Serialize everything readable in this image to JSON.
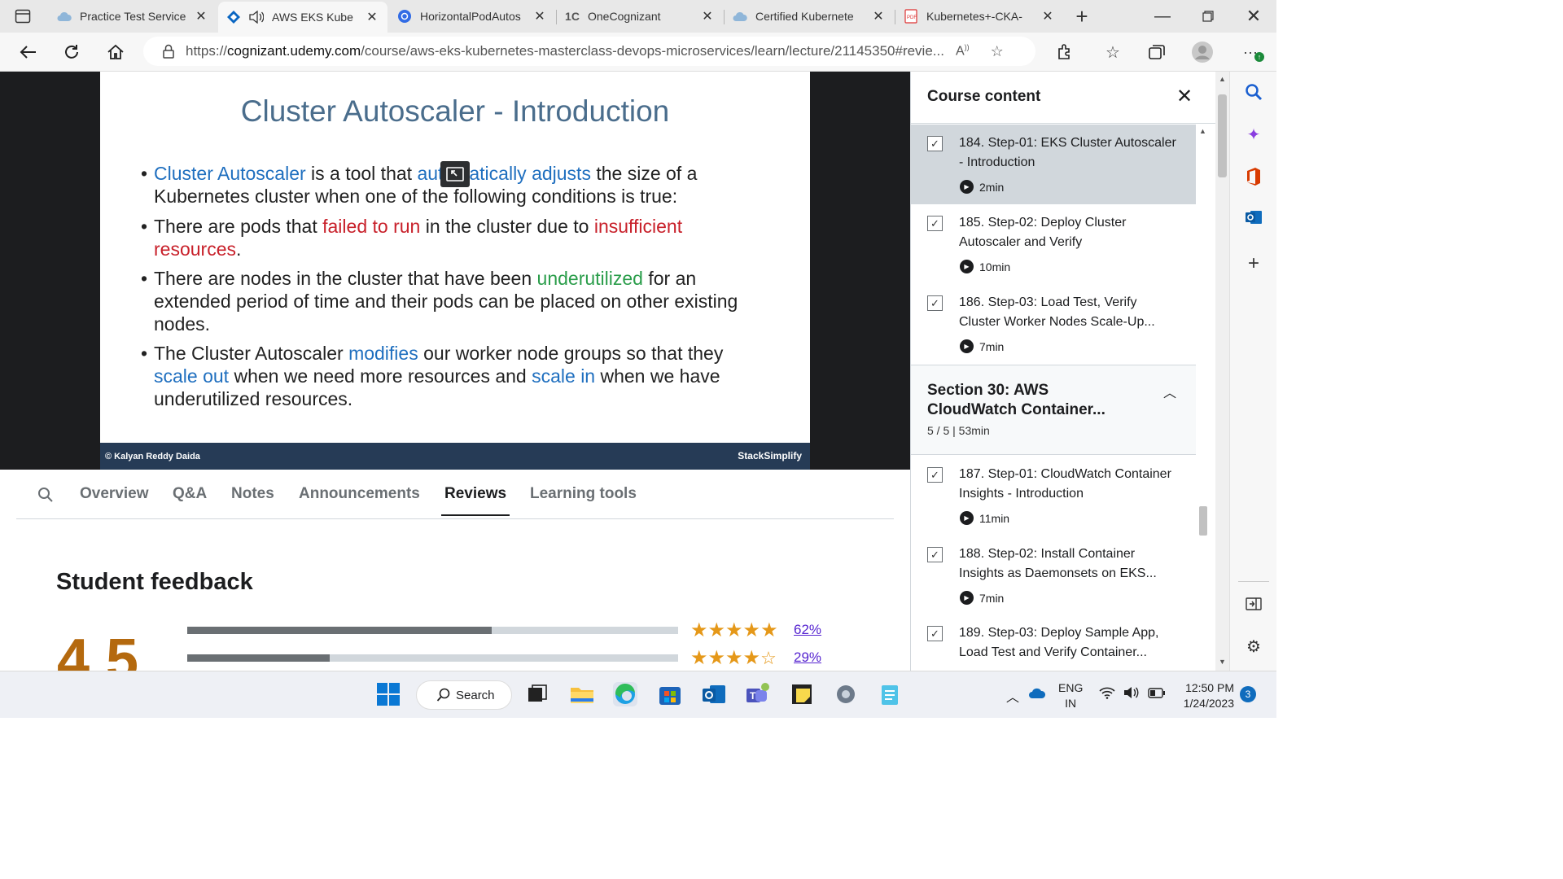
{
  "browser": {
    "tabs": [
      {
        "label": "Practice Test Service",
        "icon": "cloud-icon",
        "active": false
      },
      {
        "label": "AWS EKS Kube",
        "icon": "udemy-icon",
        "active": true,
        "audio": true
      },
      {
        "label": "HorizontalPodAutos",
        "icon": "kubernetes-icon",
        "active": false
      },
      {
        "label": "OneCognizant",
        "icon": "onecognizant-icon",
        "active": false
      },
      {
        "label": "Certified Kubernete",
        "icon": "cloud-icon",
        "active": false
      },
      {
        "label": "Kubernetes+-CKA-",
        "icon": "pdf-icon",
        "active": false
      }
    ],
    "url_prefix": "https://",
    "url_host": "cognizant.udemy.com",
    "url_path": "/course/aws-eks-kubernetes-masterclass-devops-microservices/learn/lecture/21145350#revie..."
  },
  "slide": {
    "title": "Cluster Autoscaler - Introduction",
    "bullets": [
      {
        "parts": [
          {
            "text": "Cluster Autoscaler",
            "color": "blue"
          },
          {
            "text": " is a tool that ",
            "color": ""
          },
          {
            "text": "automatically adjusts",
            "color": "blue"
          },
          {
            "text": " the size of a Kubernetes cluster when one of the following conditions is true:",
            "color": ""
          }
        ]
      },
      {
        "parts": [
          {
            "text": "There are pods that ",
            "color": ""
          },
          {
            "text": "failed to run",
            "color": "red"
          },
          {
            "text": " in the cluster due to ",
            "color": ""
          },
          {
            "text": "insufficient resources",
            "color": "red"
          },
          {
            "text": ".",
            "color": ""
          }
        ]
      },
      {
        "parts": [
          {
            "text": "There are nodes in the cluster that have been ",
            "color": ""
          },
          {
            "text": "underutilized",
            "color": "green"
          },
          {
            "text": " for an extended period of time and their pods can be placed on other existing nodes.",
            "color": ""
          }
        ]
      },
      {
        "parts": [
          {
            "text": "The Cluster Autoscaler ",
            "color": ""
          },
          {
            "text": "modifies",
            "color": "blue"
          },
          {
            "text": " our worker node groups so that they ",
            "color": ""
          },
          {
            "text": "scale out",
            "color": "blue"
          },
          {
            "text": " when we need more resources and ",
            "color": ""
          },
          {
            "text": "scale in",
            "color": "blue"
          },
          {
            "text": " when we have underutilized resources.",
            "color": ""
          }
        ]
      }
    ],
    "footer_copyright": "© Kalyan Reddy Daida",
    "footer_brand": "StackSimplify"
  },
  "lecture_tabs": [
    "Overview",
    "Q&A",
    "Notes",
    "Announcements",
    "Reviews",
    "Learning tools"
  ],
  "active_lecture_tab": "Reviews",
  "feedback": {
    "title": "Student feedback",
    "rating": "4.5",
    "rows": [
      {
        "stars": 5,
        "fill": 0.62,
        "percent": "62%"
      },
      {
        "stars": 4,
        "fill": 0.29,
        "percent": "29%"
      }
    ]
  },
  "course_content": {
    "title": "Course content",
    "lectures_top": [
      {
        "title": "184. Step-01: EKS Cluster Autoscaler - Introduction",
        "duration": "2min",
        "checked": true,
        "current": true
      },
      {
        "title": "185. Step-02: Deploy Cluster Autoscaler and Verify",
        "duration": "10min",
        "checked": true,
        "current": false
      },
      {
        "title": "186. Step-03: Load Test, Verify Cluster Worker Nodes Scale-Up...",
        "duration": "7min",
        "checked": true,
        "current": false
      }
    ],
    "section": {
      "title": "Section 30: AWS CloudWatch Container...",
      "meta": "5 / 5 | 53min"
    },
    "lectures_bottom": [
      {
        "title": "187. Step-01: CloudWatch Container Insights - Introduction",
        "duration": "11min",
        "checked": true
      },
      {
        "title": "188. Step-02: Install Container Insights as Daemonsets on EKS...",
        "duration": "7min",
        "checked": true
      },
      {
        "title": "189. Step-03: Deploy Sample App, Load Test and Verify Container...",
        "duration": "",
        "checked": true
      }
    ]
  },
  "taskbar": {
    "search_label": "Search",
    "lang_top": "ENG",
    "lang_bottom": "IN",
    "time": "12:50 PM",
    "date": "1/24/2023",
    "notification_count": "3"
  },
  "colors": {
    "rating": "#b4690e",
    "stars": "#e59819",
    "link": "#5624d0"
  }
}
